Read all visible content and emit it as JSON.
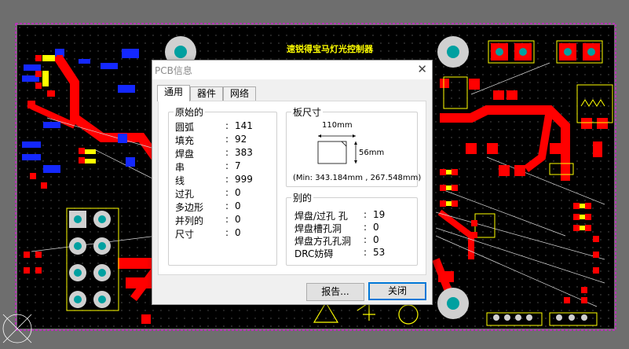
{
  "board_title": "速锐得宝马灯光控制器",
  "dialog": {
    "title": "PCB信息",
    "close_glyph": "✕",
    "tabs": [
      "通用",
      "器件",
      "网络"
    ],
    "primitives": {
      "title": "原始的",
      "rows": [
        {
          "label": "圆弧",
          "value": "141"
        },
        {
          "label": "填充",
          "value": "92"
        },
        {
          "label": "焊盘",
          "value": "383"
        },
        {
          "label": "串",
          "value": "7"
        },
        {
          "label": "线",
          "value": "999"
        },
        {
          "label": "过孔",
          "value": "0"
        },
        {
          "label": "多边形",
          "value": "0"
        },
        {
          "label": "并列的",
          "value": "0"
        },
        {
          "label": "尺寸",
          "value": "0"
        }
      ]
    },
    "board_size": {
      "title": "板尺寸",
      "width_label": "110mm",
      "height_label": "56mm",
      "min_text": "(Min: 343.184mm , 267.548mm)"
    },
    "other": {
      "title": "别的",
      "rows": [
        {
          "label": "焊盘/过孔 孔",
          "value": "19"
        },
        {
          "label": "焊盘槽孔洞",
          "value": "0"
        },
        {
          "label": "焊盘方孔孔洞",
          "value": "0"
        },
        {
          "label": "DRC妨碍",
          "value": "53"
        }
      ]
    },
    "buttons": {
      "report": "报告...",
      "close": "关闭"
    }
  },
  "colors": {
    "board": "#000000",
    "track": "#ff0000",
    "pad_top": "#ff0000",
    "pad_bottom": "#1428ff",
    "silkscreen": "#ffff00",
    "pad_teal": "#00a0a0",
    "outline": "#ff00ff"
  }
}
